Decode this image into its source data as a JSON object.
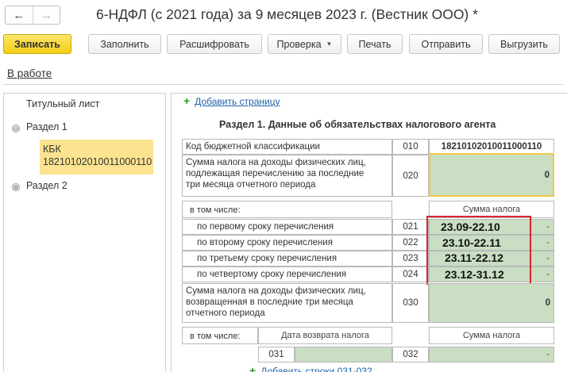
{
  "window": {
    "title": "6-НДФЛ (с 2021 года) за 9 месяцев 2023 г. (Вестник ООО) *",
    "back_glyph": "←",
    "forward_glyph": "→"
  },
  "toolbar": {
    "save_label": "Записать",
    "fill_label": "Заполнить",
    "decode_label": "Расшифровать",
    "check_label": "Проверка",
    "print_label": "Печать",
    "send_label": "Отправить",
    "export_label": "Выгрузить"
  },
  "status_link": "В работе",
  "sidebar": {
    "items": [
      {
        "label": "Титульный лист"
      },
      {
        "label": "Раздел 1",
        "expander": "⊖"
      },
      {
        "label_line1": "КБК",
        "label_line2": "18210102010011000110"
      },
      {
        "label": "Раздел 2",
        "expander": "⊕"
      }
    ]
  },
  "content": {
    "add_page_label": "Добавить страницу",
    "section_title": "Раздел 1. Данные об обязательствах налогового агента",
    "rows": {
      "kbk_label": "Код бюджетной классификации",
      "kbk_code": "010",
      "kbk_value": "18210102010011000110",
      "sum_label_1": "Сумма налога на доходы физических лиц,",
      "sum_label_2": "подлежащая перечислению за последние",
      "sum_label_3": "три месяца отчетного периода",
      "sum_code": "020",
      "sum_value": "0",
      "including_label": "в том числе:",
      "tax_sum_header": "Сумма налога",
      "terms": [
        {
          "label": "по первому сроку перечисления",
          "code": "021",
          "value": "-"
        },
        {
          "label": "по второму сроку перечисления",
          "code": "022",
          "value": "-"
        },
        {
          "label": "по третьему сроку перечисления",
          "code": "023",
          "value": "-"
        },
        {
          "label": "по четвертому сроку перечисления",
          "code": "024",
          "value": "-"
        }
      ],
      "returned_label_1": "Сумма налога на доходы физических лиц,",
      "returned_label_2": "возвращенная в последние три месяца",
      "returned_label_3": "отчетного периода",
      "returned_code": "030",
      "returned_value": "0",
      "including_label_2": "в том числе:",
      "return_date_header": "Дата возврата налога",
      "tax_sum_header_2": "Сумма налога",
      "row_031_code": "031",
      "row_032_code": "032",
      "row_032_value": "-",
      "add_rows_label": "Добавить строки 031-032"
    }
  },
  "annotations": [
    "23.09-22.10",
    "23.10-22.11",
    "23.11-22.12",
    "23.12-31.12"
  ],
  "colors": {
    "primary_button": "#f4cf16",
    "selected_tree_item": "#fbe38f",
    "input_cell": "#c9dec2",
    "annotation_border": "#d9262c",
    "link": "#1f62a8"
  }
}
